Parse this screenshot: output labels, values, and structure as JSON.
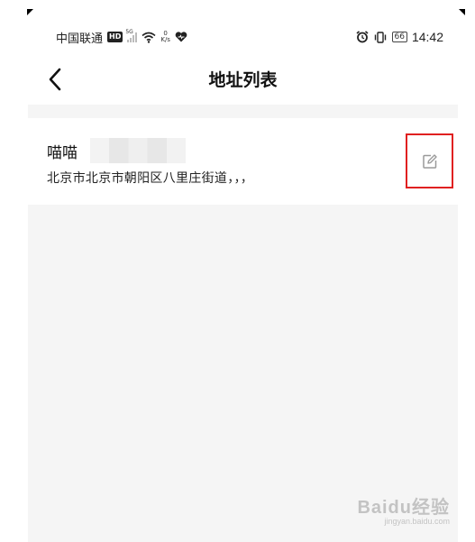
{
  "status_bar": {
    "carrier": "中国联通",
    "hd_badge": "HD",
    "network_type": "5G",
    "net_speed_value": "0",
    "net_speed_unit": "K/s",
    "battery": "66",
    "time": "14:42"
  },
  "header": {
    "title": "地址列表"
  },
  "addresses": [
    {
      "name": "喵喵",
      "detail": "北京市北京市朝阳区八里庄街道，，，"
    }
  ],
  "watermark": {
    "main": "Baidu经验",
    "sub": "jingyan.baidu.com"
  },
  "icons": {
    "back": "back-arrow-icon",
    "edit": "edit-icon",
    "alarm": "alarm-icon",
    "vibrate": "vibrate-icon",
    "wifi": "wifi-icon",
    "heart": "heart-icon"
  },
  "colors": {
    "highlight_border": "#e02020",
    "content_background": "#f5f5f5"
  }
}
